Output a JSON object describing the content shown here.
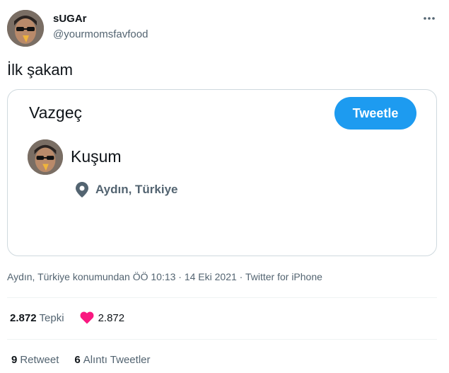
{
  "author": {
    "name": "sUGAr",
    "handle": "@yourmomsfavfood"
  },
  "tweet": {
    "text": "İlk şakam"
  },
  "embed": {
    "cancel_label": "Vazgeç",
    "tweet_button_label": "Tweetle",
    "profile_name": "Kuşum",
    "location": "Aydın, Türkiye",
    "location_icon": "location-pin-icon"
  },
  "meta": {
    "text": "Aydın, Türkiye konumundan ÖÖ 10:13 · 14 Eki 2021 · Twitter for iPhone"
  },
  "stats": {
    "reactions_count": "2.872",
    "reactions_label": "Tepki",
    "likes_count": "2.872",
    "retweets_count": "9",
    "retweets_label": "Retweet",
    "quotes_count": "6",
    "quotes_label": "Alıntı Tweetler"
  },
  "colors": {
    "accent": "#1d9bf0",
    "heart": "#f91880",
    "muted_text": "#536471",
    "border": "#cfd9de"
  }
}
